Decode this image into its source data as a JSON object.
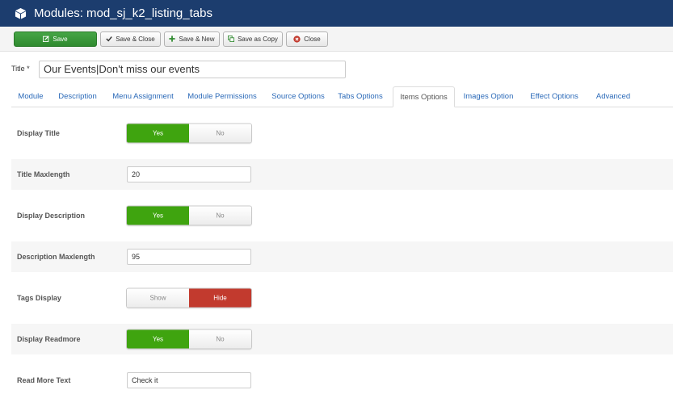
{
  "header": {
    "title": "Modules: mod_sj_k2_listing_tabs",
    "bg_color": "#1c3d6e"
  },
  "toolbar": {
    "save_label": "Save",
    "save_close_label": "Save & Close",
    "save_new_label": "Save & New",
    "save_copy_label": "Save as Copy",
    "close_label": "Close"
  },
  "title_field": {
    "label": "Title *",
    "value": "Our Events|Don't miss our events"
  },
  "tabs": [
    {
      "label": "Module"
    },
    {
      "label": "Description"
    },
    {
      "label": "Menu Assignment"
    },
    {
      "label": "Module Permissions"
    },
    {
      "label": "Source Options"
    },
    {
      "label": "Tabs Options"
    },
    {
      "label": "Items Options",
      "active": true
    },
    {
      "label": "Images Option"
    },
    {
      "label": "Effect Options"
    },
    {
      "label": "Advanced"
    }
  ],
  "fields": {
    "display_title": {
      "label": "Display Title",
      "yes": "Yes",
      "no": "No",
      "selected": "Yes"
    },
    "title_maxlength": {
      "label": "Title Maxlength",
      "value": "20"
    },
    "display_description": {
      "label": "Display Description",
      "yes": "Yes",
      "no": "No",
      "selected": "Yes"
    },
    "description_maxlength": {
      "label": "Description Maxlength",
      "value": "95"
    },
    "tags_display": {
      "label": "Tags Display",
      "show": "Show",
      "hide": "Hide",
      "selected": "Hide"
    },
    "display_readmore": {
      "label": "Display Readmore",
      "yes": "Yes",
      "no": "No",
      "selected": "Yes"
    },
    "read_more_text": {
      "label": "Read More Text",
      "value": "Check it"
    }
  },
  "colors": {
    "green": "#3fa40f",
    "red": "#c23a2e",
    "link": "#2a69b8"
  }
}
